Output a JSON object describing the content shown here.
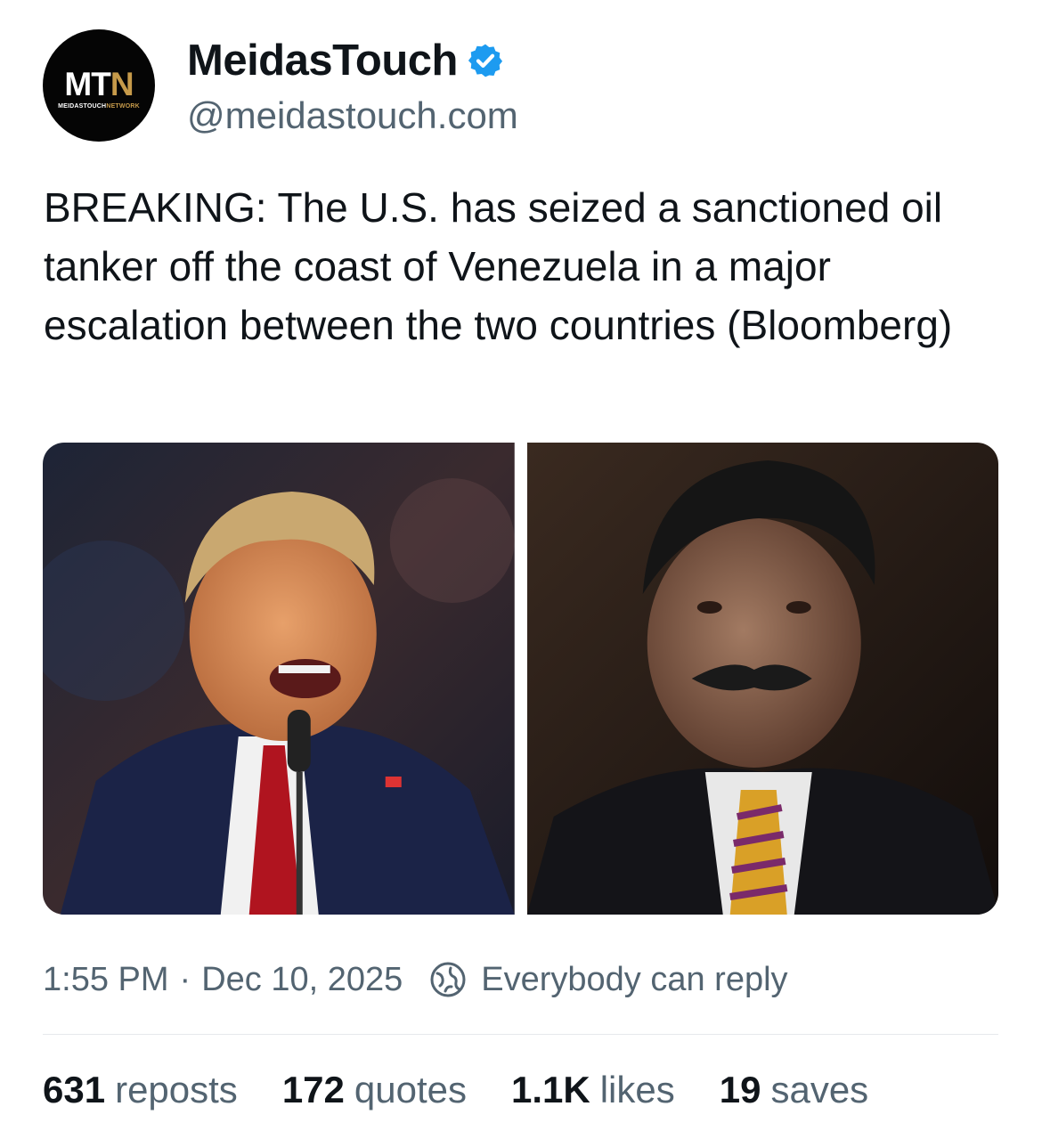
{
  "author": {
    "display_name": "MeidasTouch",
    "handle": "@meidastouch.com",
    "verified": true,
    "avatar": {
      "logo_main": "MT",
      "logo_accent": "N",
      "logo_sub_main": "MEIDASTOUCH",
      "logo_sub_accent": "NETWORK"
    }
  },
  "post": {
    "text": "BREAKING: The U.S. has seized a sanctioned oil tanker off the coast of Venezuela in a major escalation between the two countries (Bloomberg)",
    "media": [
      {
        "name": "photo-left"
      },
      {
        "name": "photo-right"
      }
    ],
    "time": "1:55 PM",
    "separator": "·",
    "date": "Dec 10, 2025",
    "reply_setting": "Everybody can reply"
  },
  "stats": {
    "reposts": {
      "count": "631",
      "label": "reposts"
    },
    "quotes": {
      "count": "172",
      "label": "quotes"
    },
    "likes": {
      "count": "1.1K",
      "label": "likes"
    },
    "saves": {
      "count": "19",
      "label": "saves"
    }
  },
  "colors": {
    "accent": "#1d9bf0",
    "text_primary": "#0f1419",
    "text_secondary": "#536471",
    "logo_gold": "#c69a4a"
  }
}
